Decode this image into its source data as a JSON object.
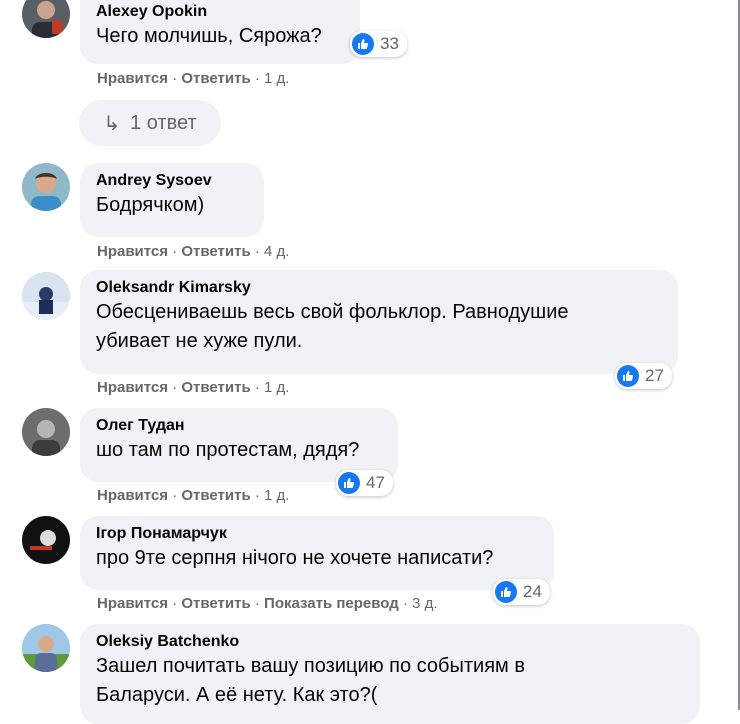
{
  "comments": [
    {
      "author": "Alexey Opokin",
      "text": "Чего молчишь, Сярожа?",
      "like": "Нравится",
      "reply": "Ответить",
      "time": "1 д.",
      "reactions": "33"
    },
    {
      "author": "Andrey Sysoev",
      "text": "Бодрячком)",
      "like": "Нравится",
      "reply": "Ответить",
      "time": "4 д."
    },
    {
      "author": "Oleksandr Kimarsky",
      "text1": "Обесцениваешь весь свой фольклор. Равнодушие",
      "text2": "убивает не хуже пули.",
      "like": "Нравится",
      "reply": "Ответить",
      "time": "1 д.",
      "reactions": "27"
    },
    {
      "author": "Олег Тудан",
      "text": "шо там по протестам, дядя?",
      "like": "Нравится",
      "reply": "Ответить",
      "time": "1 д.",
      "reactions": "47"
    },
    {
      "author": "Ігор Понамарчук",
      "text": "про 9те серпня нічого не хочете написати?",
      "like": "Нравится",
      "reply": "Ответить",
      "translate": "Показать перевод",
      "time": "3 д.",
      "reactions": "24"
    },
    {
      "author": "Oleksiy Batchenko",
      "text1": "Зашел почитать вашу позицию по событиям в",
      "text2": "Баларуси. А её нету. Как это?("
    }
  ],
  "replies_button": {
    "arrow": "↳",
    "label": "1 ответ"
  },
  "separator": " · ",
  "colors": {
    "bubble": "#f0f2f5",
    "like": "#1877f2",
    "secondary_text": "#65676b",
    "text": "#050505"
  },
  "icons": {
    "reaction": "thumbs-up-icon",
    "reply": "reply-arrow-icon"
  }
}
